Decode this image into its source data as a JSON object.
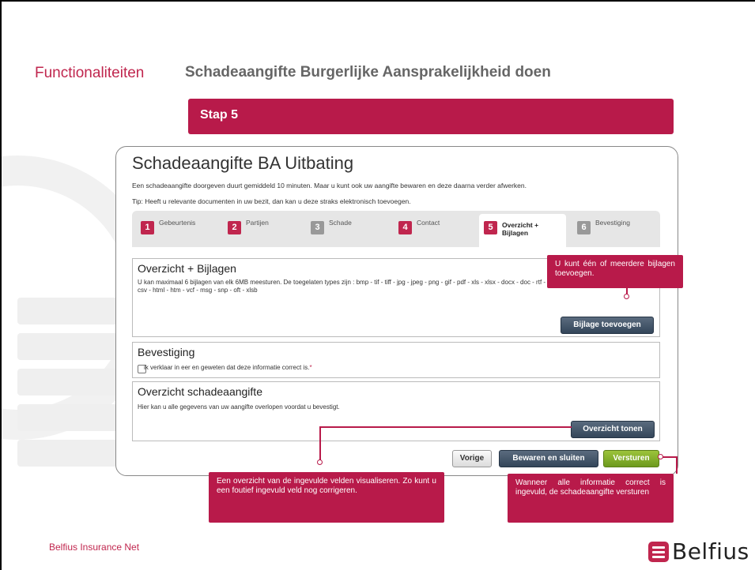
{
  "header": {
    "section_title": "Functionaliteiten",
    "page_title": "Schadeaangifte Burgerlijke Aansprakelijkheid doen"
  },
  "step_banner": {
    "label": "Stap 5"
  },
  "app": {
    "title": "Schadeaangifte BA Uitbating",
    "intro_line1": "Een schadeaangifte doorgeven duurt gemiddeld 10 minuten. Maar u kunt ook uw aangifte bewaren en deze daarna verder afwerken.",
    "intro_line2": "Tip: Heeft u relevante documenten in uw bezit, dan kan u deze straks elektronisch toevoegen.",
    "tabs": [
      {
        "num": "1",
        "label": "Gebeurtenis",
        "state": "done"
      },
      {
        "num": "2",
        "label": "Partijen",
        "state": "done"
      },
      {
        "num": "3",
        "label": "Schade",
        "state": "disabled"
      },
      {
        "num": "4",
        "label": "Contact",
        "state": "done"
      },
      {
        "num": "5",
        "label": "Overzicht + Bijlagen",
        "state": "active"
      },
      {
        "num": "6",
        "label": "Bevestiging",
        "state": "disabled"
      }
    ],
    "attachments": {
      "title": "Overzicht + Bijlagen",
      "description": "U kan maximaal 6 bijlagen van elk 6MB meesturen. De toegelaten types zijn : bmp - tif - tiff - jpg - jpeg - png - gif - pdf - xls - xlsx - docx - doc - rtf - txt - ppt -",
      "description_line2": "csv - html - htm - vcf - msg - snp - oft - xlsb",
      "add_button": "Bijlage toevoegen"
    },
    "confirmation": {
      "title": "Bevestiging",
      "checkbox_label": "ik verklaar in eer en geweten dat deze informatie correct is.",
      "required_mark": "*"
    },
    "overview": {
      "title": "Overzicht schadeaangifte",
      "description": "Hier kan u alle gegevens van uw aangifte overlopen voordat u bevestigt.",
      "show_button": "Overzicht tonen"
    },
    "buttons": {
      "previous": "Vorige",
      "save_close": "Bewaren en sluiten",
      "send": "Versturen"
    }
  },
  "callouts": {
    "attachments": "U kunt één of meerdere bijlagen toevoegen.",
    "overview": "Een overzicht van de ingevulde velden visualiseren. Zo kunt u een foutief ingevuld veld nog corrigeren.",
    "send": "Wanneer alle informatie correct is ingevuld, de schadeaangifte versturen"
  },
  "footer": {
    "company": "Belfius Insurance Net",
    "logo_text": "Belfius"
  },
  "colors": {
    "brand": "#c0264e",
    "banner": "#b81a4a",
    "send_button": "#7ea62a",
    "dark_button": "#3c4d61"
  }
}
